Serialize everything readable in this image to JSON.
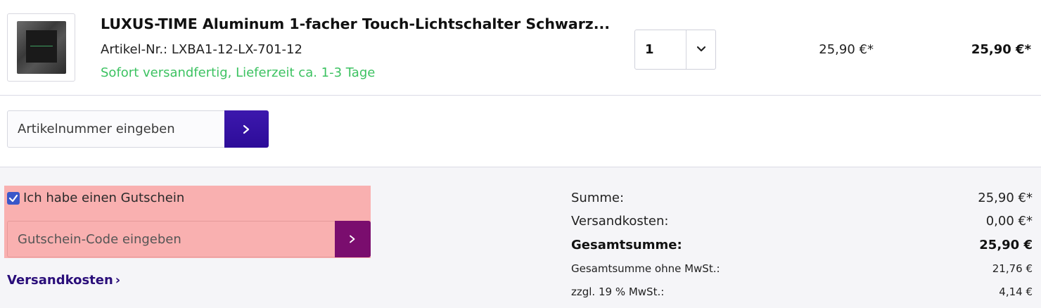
{
  "product": {
    "title": "LUXUS-TIME Aluminum 1-facher Touch-Lichtschalter Schwarz...",
    "article_number": "Artikel-Nr.: LXBA1-12-LX-701-12",
    "availability": "Sofort versandfertig, Lieferzeit ca. 1-3 Tage",
    "quantity": "1",
    "unit_price": "25,90 €*",
    "total_price": "25,90 €*",
    "thumbnail_icon": "light-switch-image"
  },
  "add_article": {
    "placeholder": "Artikelnummer eingeben",
    "button_icon": "chevron-right-icon"
  },
  "voucher": {
    "checked": true,
    "label": "Ich habe einen Gutschein",
    "placeholder": "Gutschein-Code eingeben",
    "button_icon": "chevron-right-icon"
  },
  "shipping_link": {
    "label": "Versandkosten",
    "chevron": "›"
  },
  "summary": {
    "sum_label": "Summe:",
    "sum_value": "25,90 €*",
    "shipping_label": "Versandkosten:",
    "shipping_value": "0,00 €*",
    "grand_total_label": "Gesamtsumme:",
    "grand_total_value": "25,90 €",
    "net_label": "Gesamtsumme ohne MwSt.:",
    "net_value": "21,76 €",
    "vat_label": "zzgl. 19 % MwSt.:",
    "vat_value": "4,14 €"
  },
  "colors": {
    "accent_purple": "#2d0c99",
    "voucher_button": "#7a0d6e",
    "stock_green": "#3cc261",
    "highlight": "#f9b0b0"
  }
}
